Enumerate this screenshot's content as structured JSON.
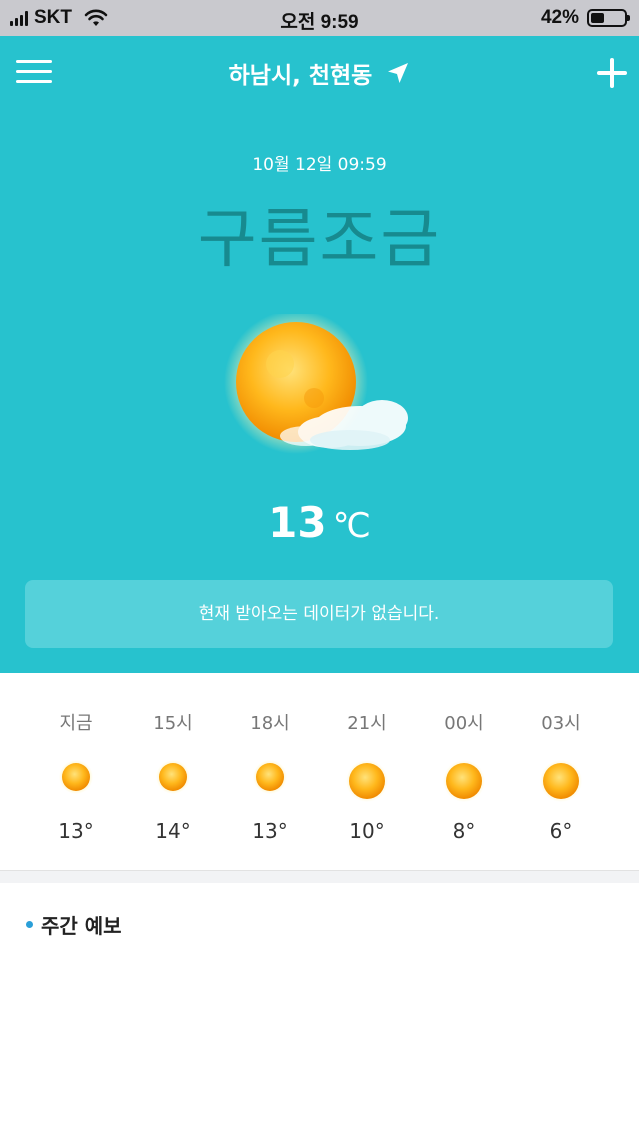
{
  "status_bar": {
    "carrier": "SKT",
    "time": "오전 9:59",
    "battery": "42%",
    "battery_level": 0.42
  },
  "header": {
    "location": "하남시, 천현동",
    "menu_icon": "hamburger-menu-icon",
    "location_icon": "location-arrow-icon",
    "add_icon": "plus-icon"
  },
  "current": {
    "datetime": "10월 12일 09:59",
    "condition": "구름조금",
    "condition_icon": "sun-with-cloud-icon",
    "temp_value": "13",
    "temp_unit": "℃",
    "notice": "현재 받아오는 데이터가 없습니다."
  },
  "hourly": [
    {
      "label": "지금",
      "temp": "13°",
      "icon": "sun-icon"
    },
    {
      "label": "15시",
      "temp": "14°",
      "icon": "sun-icon"
    },
    {
      "label": "18시",
      "temp": "13°",
      "icon": "sun-icon"
    },
    {
      "label": "21시",
      "temp": "10°",
      "icon": "moon-sun-icon"
    },
    {
      "label": "00시",
      "temp": "8°",
      "icon": "moon-sun-icon"
    },
    {
      "label": "03시",
      "temp": "6°",
      "icon": "moon-sun-icon"
    }
  ],
  "weekly": {
    "title": "주간 예보"
  },
  "colors": {
    "hero_bg": "#27c2ce",
    "condition_text": "#178a8f",
    "notice_bg": "#55d1da",
    "bullet": "#2a9fd8"
  }
}
